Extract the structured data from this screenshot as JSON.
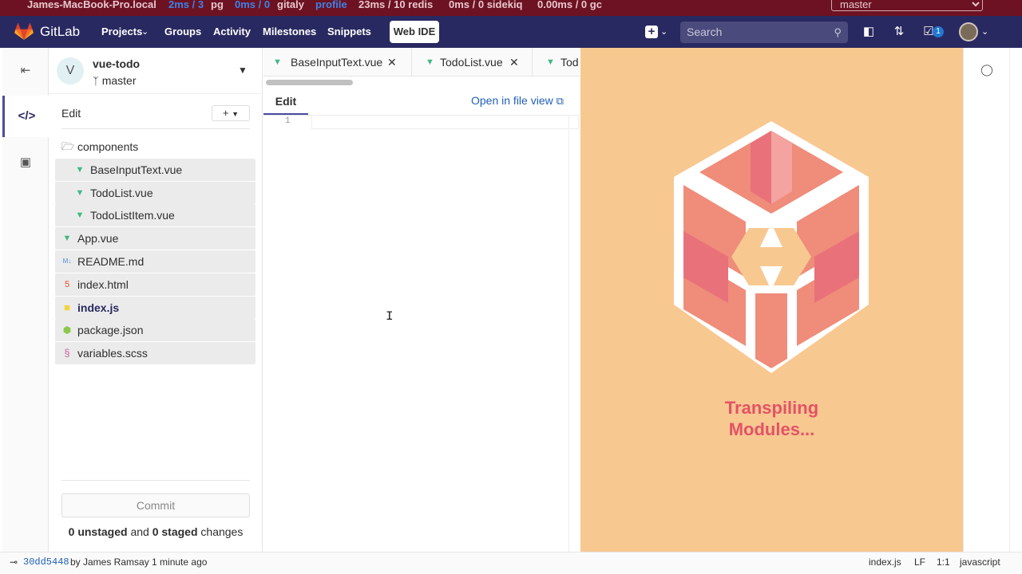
{
  "perf_bar": {
    "host": "James-MacBook-Pro.local",
    "pg": "2ms / 3",
    "pg_label": "pg",
    "gitaly": "0ms / 0",
    "gitaly_label": "gitaly",
    "profile": "profile",
    "redis": "23ms / 10 redis",
    "sidekiq": "0ms / 0 sidekiq",
    "gc": "0.00ms / 0 gc",
    "branch_select": "master"
  },
  "navbar": {
    "brand": "GitLab",
    "projects": "Projects",
    "groups": "Groups",
    "activity": "Activity",
    "milestones": "Milestones",
    "snippets": "Snippets",
    "web_ide": "Web IDE",
    "search_placeholder": "Search",
    "todos_count": "1"
  },
  "project": {
    "avatar_letter": "V",
    "name": "vue-todo",
    "branch": "master"
  },
  "sidebar": {
    "edit_label": "Edit",
    "new_button": "+",
    "commit_button": "Commit",
    "changes": {
      "unstaged_count": "0",
      "unstaged_label": "unstaged",
      "and": "and",
      "staged_count": "0",
      "staged_label": "staged",
      "suffix": "changes"
    }
  },
  "file_tree": [
    {
      "name": "components",
      "icon": "folder-open-icon",
      "level": 0,
      "shaded": false,
      "active": false
    },
    {
      "name": "BaseInputText.vue",
      "icon": "vue-icon",
      "level": 1,
      "shaded": true,
      "active": false
    },
    {
      "name": "TodoList.vue",
      "icon": "vue-icon",
      "level": 1,
      "shaded": true,
      "active": false
    },
    {
      "name": "TodoListItem.vue",
      "icon": "vue-icon",
      "level": 1,
      "shaded": true,
      "active": false
    },
    {
      "name": "App.vue",
      "icon": "vue-icon",
      "level": 0,
      "shaded": true,
      "active": false
    },
    {
      "name": "README.md",
      "icon": "markdown-icon",
      "level": 0,
      "shaded": true,
      "active": false
    },
    {
      "name": "index.html",
      "icon": "html5-icon",
      "level": 0,
      "shaded": true,
      "active": false
    },
    {
      "name": "index.js",
      "icon": "javascript-icon",
      "level": 0,
      "shaded": true,
      "active": true
    },
    {
      "name": "package.json",
      "icon": "nodejs-icon",
      "level": 0,
      "shaded": true,
      "active": false
    },
    {
      "name": "variables.scss",
      "icon": "sass-icon",
      "level": 0,
      "shaded": true,
      "active": false
    }
  ],
  "editor": {
    "tabs": [
      {
        "name": "BaseInputText.vue"
      },
      {
        "name": "TodoList.vue"
      },
      {
        "name": "Tod"
      }
    ],
    "edit_tab": "Edit",
    "open_in_file_view": "Open in file view",
    "line_number": "1"
  },
  "preview": {
    "line1": "Transpiling",
    "line2": "Modules..."
  },
  "status_bar": {
    "commit_sha": "30dd5448",
    "commit_by": "by James Ramsay 1 minute ago",
    "file": "index.js",
    "eol": "LF",
    "position": "1:1",
    "language": "javascript"
  },
  "colors": {
    "navbar": "#292961",
    "perf_bar": "#6c1222",
    "preview_bg": "#f8c891",
    "preview_text": "#e45266",
    "vue_green": "#41b883",
    "link_blue": "#1f5fb8"
  }
}
